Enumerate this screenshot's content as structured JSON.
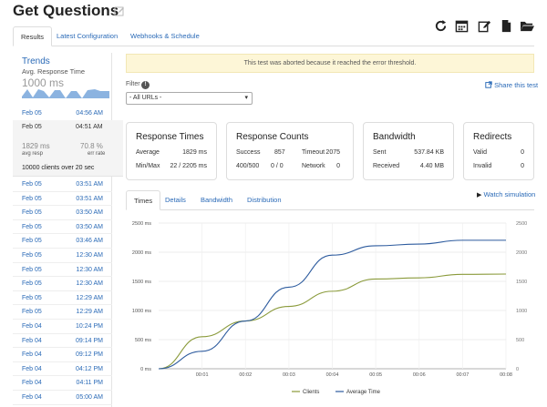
{
  "header": {
    "title": "Get Questions"
  },
  "tabs": [
    {
      "label": "Results"
    },
    {
      "label": "Latest Configuration"
    },
    {
      "label": "Webhooks & Schedule"
    }
  ],
  "sidebar": {
    "trends_title": "Trends",
    "trends_subtitle": "Avg. Response Time",
    "trends_value": "1000 ms",
    "top_row": {
      "date": "Feb 05",
      "time": "04:56 AM"
    },
    "selected": {
      "date": "Feb 05",
      "time": "04:51 AM",
      "avg_resp": "1829 ms",
      "avg_resp_label": "avg resp",
      "err_rate": "70.8 %",
      "err_rate_label": "err rate",
      "summary": "10000 clients over 20 sec"
    },
    "rows": [
      {
        "date": "Feb 05",
        "time": "03:51 AM"
      },
      {
        "date": "Feb 05",
        "time": "03:51 AM"
      },
      {
        "date": "Feb 05",
        "time": "03:50 AM"
      },
      {
        "date": "Feb 05",
        "time": "03:50 AM"
      },
      {
        "date": "Feb 05",
        "time": "03:46 AM"
      },
      {
        "date": "Feb 05",
        "time": "12:30 AM"
      },
      {
        "date": "Feb 05",
        "time": "12:30 AM"
      },
      {
        "date": "Feb 05",
        "time": "12:30 AM"
      },
      {
        "date": "Feb 05",
        "time": "12:29 AM"
      },
      {
        "date": "Feb 05",
        "time": "12:29 AM"
      },
      {
        "date": "Feb 04",
        "time": "10:24 PM"
      },
      {
        "date": "Feb 04",
        "time": "09:14 PM"
      },
      {
        "date": "Feb 04",
        "time": "09:12 PM"
      },
      {
        "date": "Feb 04",
        "time": "04:12 PM"
      },
      {
        "date": "Feb 04",
        "time": "04:11 PM"
      },
      {
        "date": "Feb 04",
        "time": "05:00 AM"
      }
    ]
  },
  "notice": "This test was aborted because it reached the error threshold.",
  "filter": {
    "label": "Filter",
    "value": "- All URLs -",
    "info_glyph": "!"
  },
  "share_label": "Share this test",
  "cards": {
    "response_times": {
      "title": "Response Times",
      "avg_label": "Average",
      "avg_value": "1829 ms",
      "minmax_label": "Min/Max",
      "minmax_value": "22 / 2205 ms"
    },
    "response_counts": {
      "title": "Response Counts",
      "success_label": "Success",
      "success_value": "857",
      "timeout_label": "Timeout",
      "timeout_value": "2075",
      "code_label": "400/500",
      "code_value": "0 / 0",
      "network_label": "Network",
      "network_value": "0"
    },
    "bandwidth": {
      "title": "Bandwidth",
      "sent_label": "Sent",
      "sent_value": "537.84 KB",
      "received_label": "Received",
      "received_value": "4.40 MB"
    },
    "redirects": {
      "title": "Redirects",
      "valid_label": "Valid",
      "valid_value": "0",
      "invalid_label": "Invalid",
      "invalid_value": "0"
    }
  },
  "chart_tabs": [
    {
      "label": "Times"
    },
    {
      "label": "Details"
    },
    {
      "label": "Bandwidth"
    },
    {
      "label": "Distribution"
    }
  ],
  "watch_label": "Watch simulation",
  "colors": {
    "link": "#2a6ab7",
    "clients": "#8a9a3a",
    "avg_time": "#2d5b9e",
    "notice_bg": "#fdf6d7"
  },
  "icons": [
    "refresh-icon",
    "calendar-icon",
    "edit-icon",
    "document-icon",
    "folder-icon",
    "play-icon",
    "share-icon",
    "info-icon",
    "pencil-icon"
  ],
  "chart_data": {
    "type": "line",
    "x": [
      "00:00",
      "00:01",
      "00:02",
      "00:03",
      "00:04",
      "00:05",
      "00:06",
      "00:07",
      "00:08"
    ],
    "x_tick_labels": [
      "00:01",
      "00:02",
      "00:03",
      "00:04",
      "00:05",
      "00:06",
      "00:07",
      "00:08"
    ],
    "y_left_ticks": [
      "0 ms",
      "500 ms",
      "1000 ms",
      "1500 ms",
      "2000 ms",
      "2500 ms"
    ],
    "y_right_ticks": [
      "0",
      "500",
      "1000",
      "1500",
      "2000",
      "2500"
    ],
    "ylim": [
      0,
      2500
    ],
    "series": [
      {
        "name": "Clients",
        "axis": "right",
        "values": [
          0,
          550,
          820,
          1070,
          1330,
          1540,
          1560,
          1620,
          1625
        ]
      },
      {
        "name": "Average Time",
        "axis": "left",
        "values": [
          0,
          300,
          820,
          1400,
          1950,
          2110,
          2140,
          2205,
          2205
        ]
      }
    ],
    "grid": true,
    "legend": "bottom-center"
  }
}
